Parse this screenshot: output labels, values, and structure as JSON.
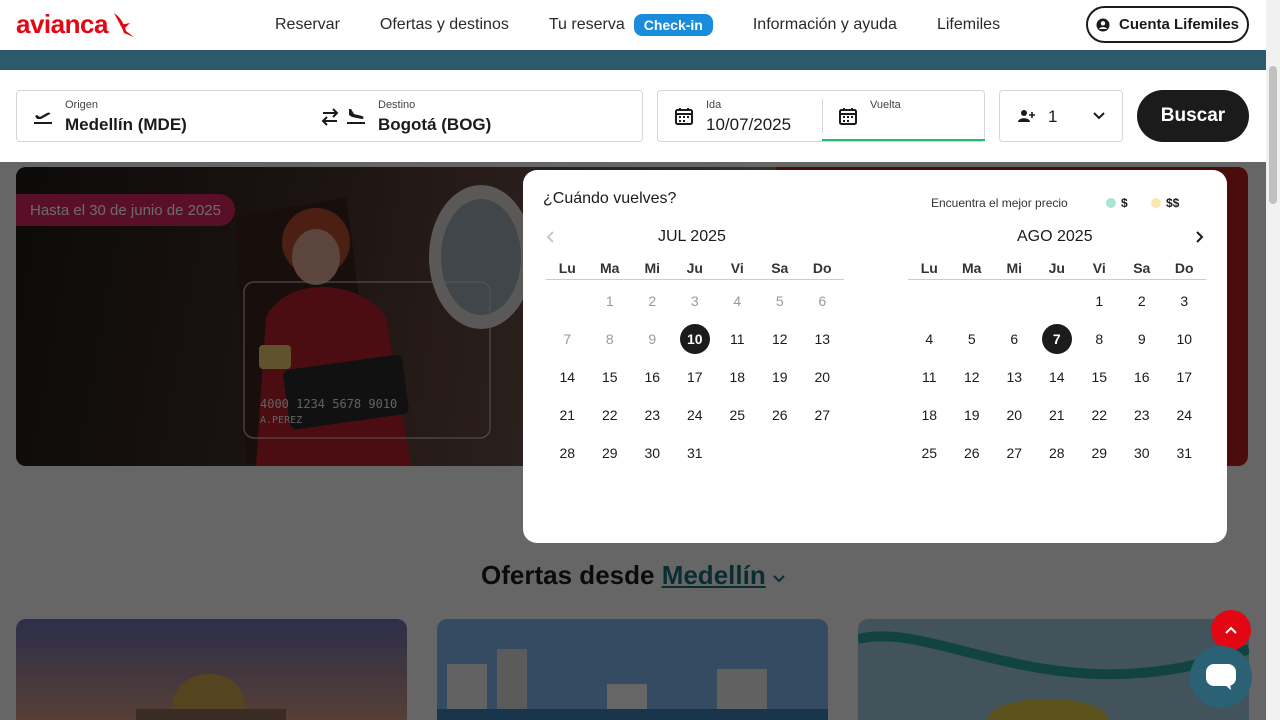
{
  "header": {
    "logo_text": "avianca",
    "nav": [
      "Reservar",
      "Ofertas y destinos",
      "Tu reserva",
      "Información y ayuda",
      "Lifemiles"
    ],
    "checkin_label": "Check-in",
    "account_label": "Cuenta Lifemiles"
  },
  "search": {
    "origin_label": "Origen",
    "origin_value": "Medellín (MDE)",
    "dest_label": "Destino",
    "dest_value": "Bogotá (BOG)",
    "ida_label": "Ida",
    "ida_value": "10/07/2025",
    "vuelta_label": "Vuelta",
    "vuelta_value": "",
    "passengers": "1",
    "search_button": "Buscar"
  },
  "hero": {
    "badge": "Hasta el 30 de junio de 2025",
    "card_number": "4000 1234 5678 9010",
    "card_name": "A.PEREZ"
  },
  "calendar": {
    "title": "¿Cuándo vuelves?",
    "best_price_label": "Encuentra el mejor precio",
    "legend_low": "$",
    "legend_high": "$$",
    "legend_low_color": "#a8e6cf",
    "legend_high_color": "#fde7b0",
    "weekdays": [
      "Lu",
      "Ma",
      "Mi",
      "Ju",
      "Vi",
      "Sa",
      "Do"
    ],
    "months": [
      {
        "name": "JUL 2025",
        "days": [
          [
            "",
            "1",
            "2",
            "3",
            "4",
            "5",
            "6"
          ],
          [
            "7",
            "8",
            "9",
            "10",
            "11",
            "12",
            "13"
          ],
          [
            "14",
            "15",
            "16",
            "17",
            "18",
            "19",
            "20"
          ],
          [
            "21",
            "22",
            "23",
            "24",
            "25",
            "26",
            "27"
          ],
          [
            "28",
            "29",
            "30",
            "31",
            "",
            "",
            ""
          ]
        ],
        "muted": [
          "1",
          "2",
          "3",
          "4",
          "5",
          "6",
          "7",
          "8",
          "9"
        ],
        "selected": "10"
      },
      {
        "name": "AGO 2025",
        "days": [
          [
            "",
            "",
            "",
            "",
            "1",
            "2",
            "3"
          ],
          [
            "4",
            "5",
            "6",
            "7",
            "8",
            "9",
            "10"
          ],
          [
            "11",
            "12",
            "13",
            "14",
            "15",
            "16",
            "17"
          ],
          [
            "18",
            "19",
            "20",
            "21",
            "22",
            "23",
            "24"
          ],
          [
            "25",
            "26",
            "27",
            "28",
            "29",
            "30",
            "31"
          ]
        ],
        "muted": [],
        "selected": "7"
      }
    ]
  },
  "offers": {
    "prefix": "Ofertas desde",
    "city": "Medellín"
  },
  "colors": {
    "brand_red": "#e30613",
    "checkin_blue": "#1a8cdc",
    "teal": "#1a6d78"
  }
}
